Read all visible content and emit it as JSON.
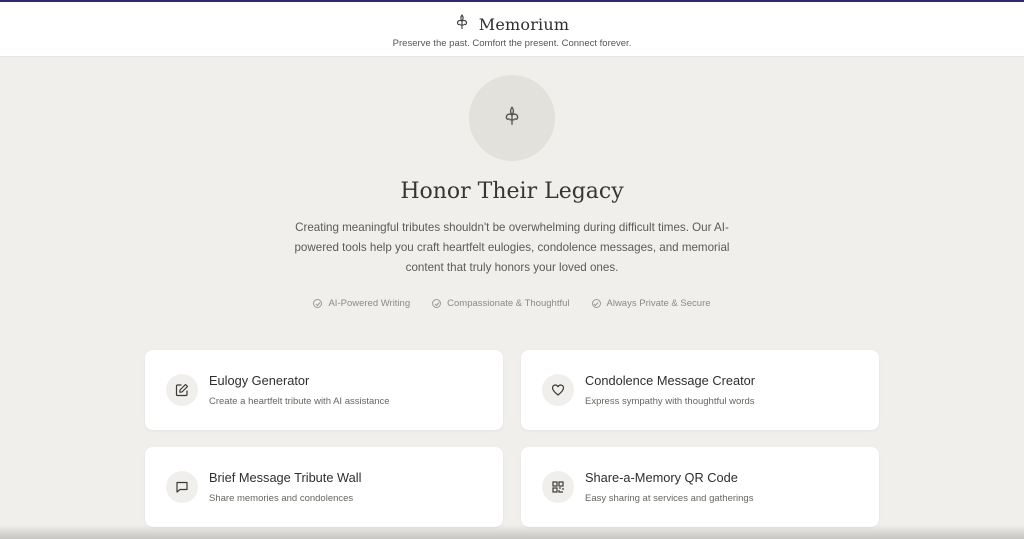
{
  "header": {
    "brand_name": "Memorium",
    "tagline": "Preserve the past. Comfort the present. Connect forever.",
    "logo_icon": "fleur-de-lis-icon"
  },
  "hero": {
    "icon": "fleur-de-lis-icon",
    "title": "Honor Their Legacy",
    "description": "Creating meaningful tributes shouldn't be overwhelming during difficult times. Our AI-powered tools help you craft heartfelt eulogies, condolence messages, and memorial content that truly honors your loved ones.",
    "features": [
      {
        "label": "AI-Powered Writing",
        "icon": "check-circle-icon"
      },
      {
        "label": "Compassionate & Thoughtful",
        "icon": "check-circle-icon"
      },
      {
        "label": "Always Private & Secure",
        "icon": "check-circle-icon"
      }
    ]
  },
  "cards": [
    {
      "title": "Eulogy Generator",
      "subtitle": "Create a heartfelt tribute with AI assistance",
      "icon": "edit-icon"
    },
    {
      "title": "Condolence Message Creator",
      "subtitle": "Express sympathy with thoughtful words",
      "icon": "heart-icon"
    },
    {
      "title": "Brief Message Tribute Wall",
      "subtitle": "Share memories and condolences",
      "icon": "message-icon"
    },
    {
      "title": "Share-a-Memory QR Code",
      "subtitle": "Easy sharing at services and gatherings",
      "icon": "qr-code-icon"
    }
  ],
  "colors": {
    "background": "#f0efeb",
    "card": "#ffffff",
    "accent_line": "#2e2a6b",
    "text": "#3a3a38"
  }
}
